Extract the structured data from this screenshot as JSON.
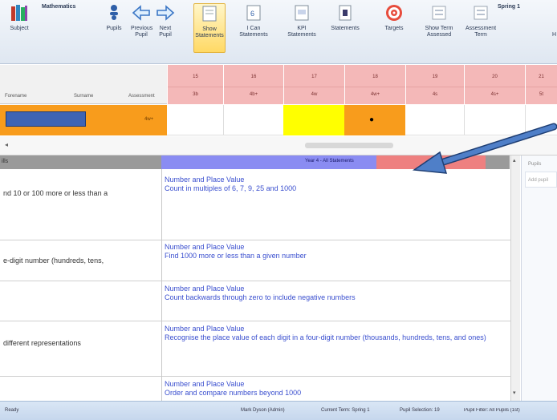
{
  "ribbon": {
    "subject_title": "Mathematics",
    "buttons": [
      {
        "label": "Subject",
        "icon": "books-icon"
      },
      {
        "label": "Pupils",
        "icon": "pupils-icon"
      },
      {
        "label": "Previous Pupil",
        "icon": "left-arrow-icon"
      },
      {
        "label": "Next Pupil",
        "icon": "right-arrow-icon"
      },
      {
        "label": "Show Statements",
        "icon": "show-statements-icon"
      },
      {
        "label": "I Can Statements",
        "icon": "i-can-icon"
      },
      {
        "label": "KPI Statements",
        "icon": "kpi-icon"
      },
      {
        "label": "Statements",
        "icon": "statements-icon"
      },
      {
        "label": "Targets",
        "icon": "target-icon"
      },
      {
        "label": "Show Term Assessed",
        "icon": "term-assessed-icon"
      },
      {
        "label": "Assessment Term",
        "icon": "assessment-term-icon"
      }
    ],
    "term": "Spring 1",
    "h_label": "H"
  },
  "grid": {
    "col_headers": [
      "Forename",
      "Surname",
      "Assessment"
    ],
    "pink_columns": [
      {
        "num": "15",
        "sub": "3b"
      },
      {
        "num": "16",
        "sub": "4b+"
      },
      {
        "num": "17",
        "sub": "4w"
      },
      {
        "num": "18",
        "sub": "4w+"
      },
      {
        "num": "19",
        "sub": "4s"
      },
      {
        "num": "20",
        "sub": "4s+"
      },
      {
        "num": "21",
        "sub": "5t"
      }
    ],
    "pupil_assessment": "4w+",
    "marker": "●"
  },
  "statements": {
    "left_header": "ills",
    "band_title": "Year 4 - All Statements",
    "rows": [
      {
        "left": "nd 10 or 100 more or less than a",
        "category": "Number and Place Value",
        "text": "Count in multiples of 6, 7, 9, 25 and 1000"
      },
      {
        "left": "e-digit number (hundreds, tens,",
        "category": "Number and Place Value",
        "text": "Find 1000 more or less than a given number"
      },
      {
        "left": "",
        "category": "Number and Place Value",
        "text": "Count backwards through zero to include negative numbers"
      },
      {
        "left": "different representations",
        "category": "Number and Place Value",
        "text": "Recognise the place value of each digit in a four-digit number (thousands, hundreds, tens, and ones)"
      },
      {
        "left": "",
        "category": "Number and Place Value",
        "text": "Order and compare numbers beyond 1000"
      }
    ]
  },
  "side_panel": {
    "title": "Pupils",
    "placeholder": "Add pupil"
  },
  "status": {
    "ready": "Ready",
    "user": "Mark Dyson (Admin)",
    "term": "Current Term: Spring 1",
    "selection": "Pupil Selection: 19",
    "filter": "Pupil Filter: All Pupils (1st)"
  },
  "colors": {
    "accent_blue": "#8a8cf2",
    "accent_pink": "#ee8080",
    "orange": "#f89c1c",
    "link_blue": "#3a4fcf",
    "arrow": "#3f6fb8"
  }
}
